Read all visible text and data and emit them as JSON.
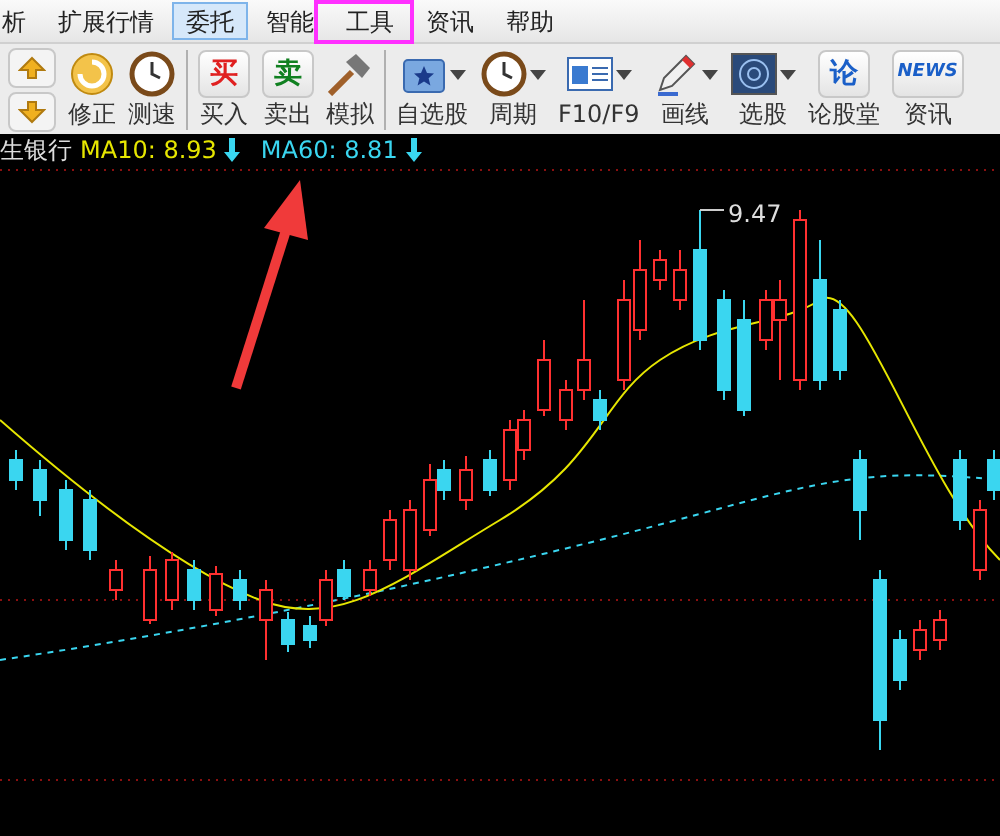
{
  "menu": [
    {
      "label": "析",
      "selected": false
    },
    {
      "label": "扩展行情",
      "selected": false
    },
    {
      "label": "委托",
      "selected": true
    },
    {
      "label": "智能",
      "selected": false
    },
    {
      "label": "工具",
      "selected": false
    },
    {
      "label": "资讯",
      "selected": false
    },
    {
      "label": "帮助",
      "selected": false
    }
  ],
  "toolbar": [
    {
      "kind": "updown"
    },
    {
      "kind": "button",
      "label": "修正"
    },
    {
      "kind": "button",
      "label": "测速"
    },
    {
      "kind": "separator"
    },
    {
      "kind": "button",
      "icon_text": "买",
      "label": "买入"
    },
    {
      "kind": "button",
      "icon_text": "卖",
      "label": "卖出"
    },
    {
      "kind": "button",
      "label": "模拟"
    },
    {
      "kind": "separator"
    },
    {
      "kind": "dropdown",
      "label": "自选股"
    },
    {
      "kind": "dropdown",
      "label": "周期"
    },
    {
      "kind": "dropdown",
      "label": "F10/F9"
    },
    {
      "kind": "dropdown",
      "label": "画线"
    },
    {
      "kind": "dropdown",
      "label": "选股"
    },
    {
      "kind": "button",
      "icon_text": "论",
      "label": "论股堂"
    },
    {
      "kind": "button",
      "icon_text": "NEWS",
      "label": "资讯"
    }
  ],
  "info_bar": {
    "stock": "生银行",
    "ma10": "MA10: 8.93",
    "ma60": "MA60: 8.81"
  },
  "chart": {
    "high_label": "9.47"
  }
}
